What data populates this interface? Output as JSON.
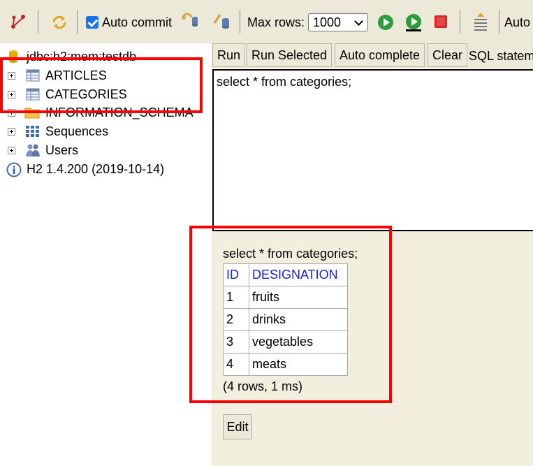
{
  "toolbar": {
    "auto_commit_label": "Auto commit",
    "max_rows_label": "Max rows:",
    "max_rows_value": "1000",
    "auto_label": "Auto"
  },
  "tree": {
    "connection": "jdbc:h2:mem:testdb",
    "items": [
      "ARTICLES",
      "CATEGORIES",
      "INFORMATION_SCHEMA",
      "Sequences",
      "Users"
    ],
    "version": "H2 1.4.200 (2019-10-14)"
  },
  "buttons": {
    "run": "Run",
    "run_selected": "Run Selected",
    "auto_complete": "Auto complete",
    "clear": "Clear",
    "sql_label": "SQL statem"
  },
  "editor": {
    "text": "select * from categories;"
  },
  "result": {
    "query": "select * from categories;",
    "columns": [
      "ID",
      "DESIGNATION"
    ],
    "rows": [
      [
        "1",
        "fruits"
      ],
      [
        "2",
        "drinks"
      ],
      [
        "3",
        "vegetables"
      ],
      [
        "4",
        "meats"
      ]
    ],
    "info": "(4 rows, 1 ms)",
    "edit_label": "Edit"
  },
  "colors": {
    "annotation": "#ff0000",
    "header_link": "#1a23d6",
    "panel": "#ece9d8"
  }
}
